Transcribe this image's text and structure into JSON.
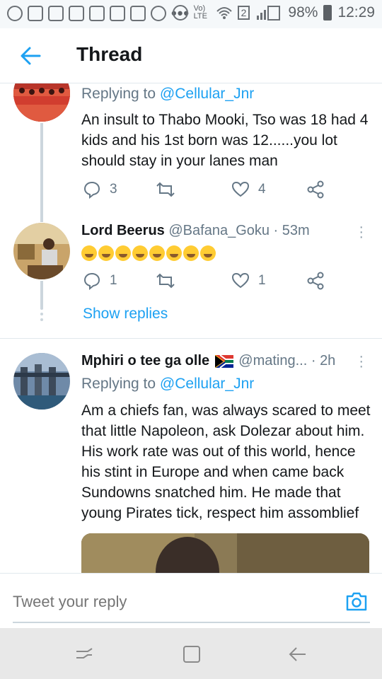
{
  "status_bar": {
    "battery": "98%",
    "time": "12:29",
    "network": "Vo) LTE",
    "sim": "2",
    "left_icons": [
      "facebook-icon",
      "missed-call-icon",
      "gmail-icon",
      "gmail-icon",
      "checkbox-icon",
      "gmail-icon",
      "gmail-icon",
      "chrome-icon"
    ],
    "overflow": "•••"
  },
  "header": {
    "title": "Thread",
    "back_icon": "arrow-left-icon"
  },
  "tweets": [
    {
      "replying_prefix": "Replying to ",
      "replying_handle": "@Cellular_Jnr",
      "text": "An insult to Thabo Mooki, Tso was 18 had 4 kids and his 1st born was 12......you lot should stay in your lanes man",
      "replies": "3",
      "likes": "4"
    },
    {
      "display_name": "Lord Beerus",
      "handle": "@Bafana_Goku",
      "time": "53m",
      "text_emojis": "rolling-laughing x4, crying x2, grinning x2",
      "replies": "1",
      "likes": "1",
      "show_replies": "Show replies"
    },
    {
      "display_name": "Mphiri o tee ga olle",
      "handle": "@mating...",
      "time": "2h",
      "replying_prefix": "Replying to ",
      "replying_handle": "@Cellular_Jnr",
      "text": "Am a chiefs fan, was always scared to meet that little Napoleon, ask Dolezar about him. His work rate was out of this world, hence his stint in Europe and when came back Sundowns snatched him. He made that young Pirates tick, respect him assomblief"
    }
  ],
  "reply_bar": {
    "placeholder": "Tweet your reply"
  },
  "colors": {
    "accent": "#1da1f2",
    "text": "#14171a",
    "muted": "#657786",
    "border": "#e1e8ed"
  }
}
